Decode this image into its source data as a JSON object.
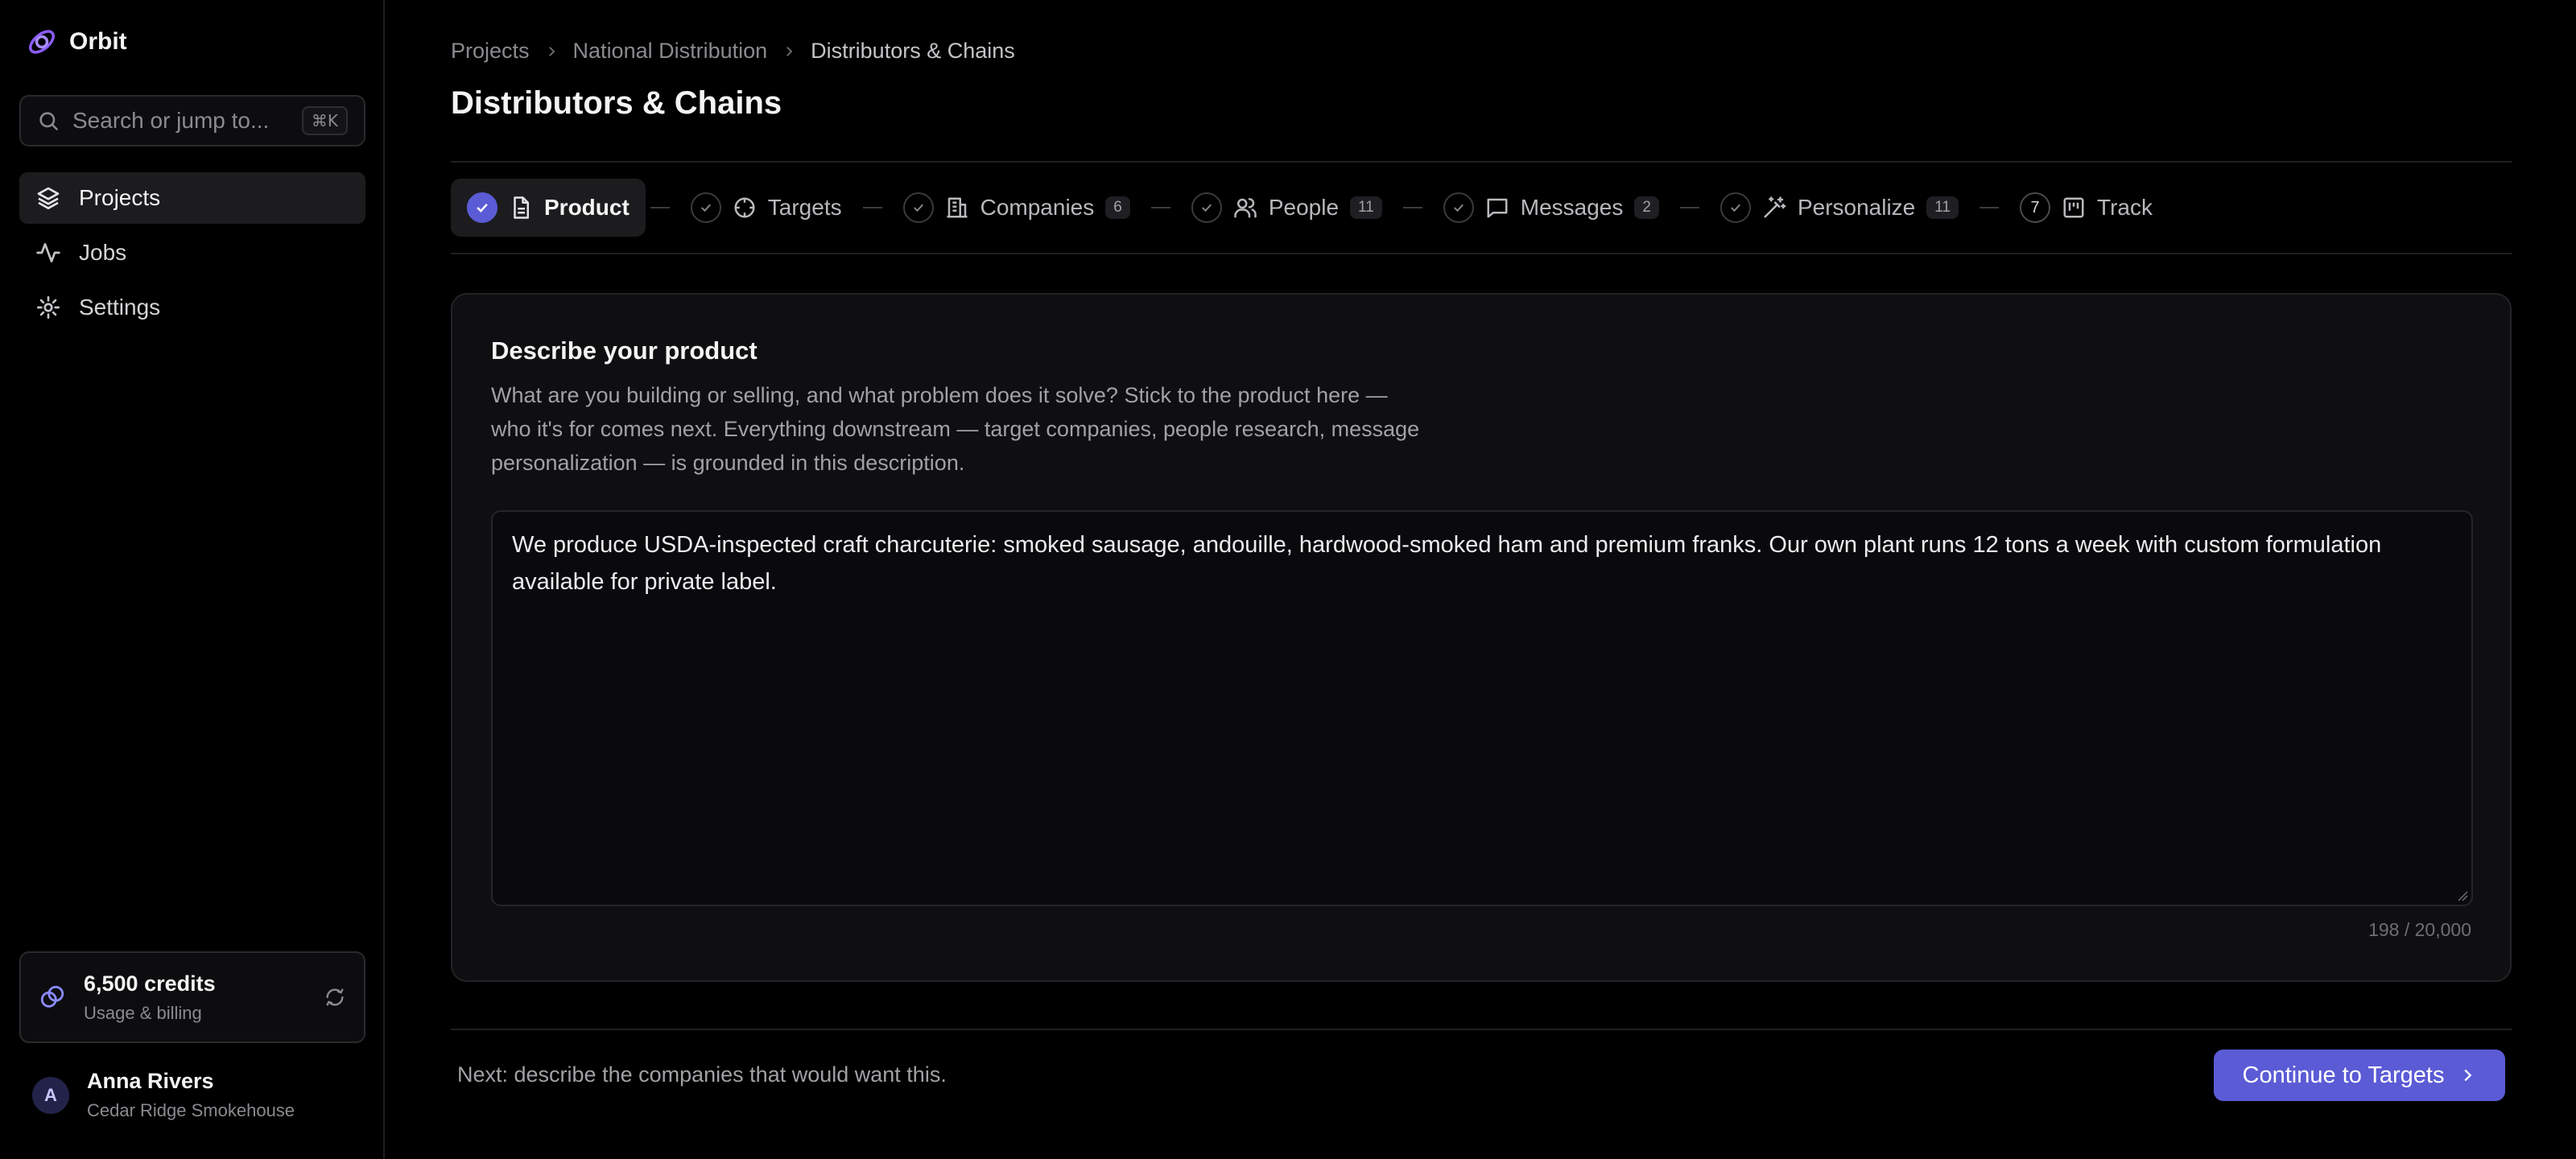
{
  "app": {
    "name": "Orbit"
  },
  "sidebar": {
    "search": {
      "placeholder": "Search or jump to...",
      "shortcut": "⌘K"
    },
    "items": [
      {
        "label": "Projects",
        "icon": "layers-icon",
        "active": true
      },
      {
        "label": "Jobs",
        "icon": "activity-icon",
        "active": false
      },
      {
        "label": "Settings",
        "icon": "gear-icon",
        "active": false
      }
    ],
    "credits": {
      "amount": "6,500 credits",
      "subtitle": "Usage & billing"
    },
    "user": {
      "initial": "A",
      "name": "Anna Rivers",
      "company": "Cedar Ridge Smokehouse"
    }
  },
  "breadcrumb": [
    "Projects",
    "National Distribution",
    "Distributors & Chains"
  ],
  "page_title": "Distributors & Chains",
  "steps": [
    {
      "label": "Product",
      "icon": "file-text-icon",
      "status": "active"
    },
    {
      "label": "Targets",
      "icon": "crosshair-icon",
      "status": "done"
    },
    {
      "label": "Companies",
      "icon": "building-icon",
      "status": "done",
      "count": "6"
    },
    {
      "label": "People",
      "icon": "users-icon",
      "status": "done",
      "count": "11"
    },
    {
      "label": "Messages",
      "icon": "message-icon",
      "status": "done",
      "count": "2"
    },
    {
      "label": "Personalize",
      "icon": "magic-wand-icon",
      "status": "done",
      "count": "11"
    },
    {
      "label": "Track",
      "icon": "kanban-icon",
      "status": "pending",
      "number": "7"
    }
  ],
  "card": {
    "heading": "Describe your product",
    "description": "What are you building or selling, and what problem does it solve? Stick to the product here — who it's for comes next. Everything downstream — target companies, people research, message personalization — is grounded in this description.",
    "textarea_value": "We produce USDA-inspected craft charcuterie: smoked sausage, andouille, hardwood-smoked ham and premium franks. Our own plant runs 12 tons a week with custom formulation available for private label.",
    "counter": "198 / 20,000"
  },
  "footer": {
    "hint": "Next: describe the companies that would want this.",
    "cta_label": "Continue to Targets"
  },
  "colors": {
    "accent": "#5b5bd6",
    "background": "#000000",
    "card": "#0f0f11"
  }
}
